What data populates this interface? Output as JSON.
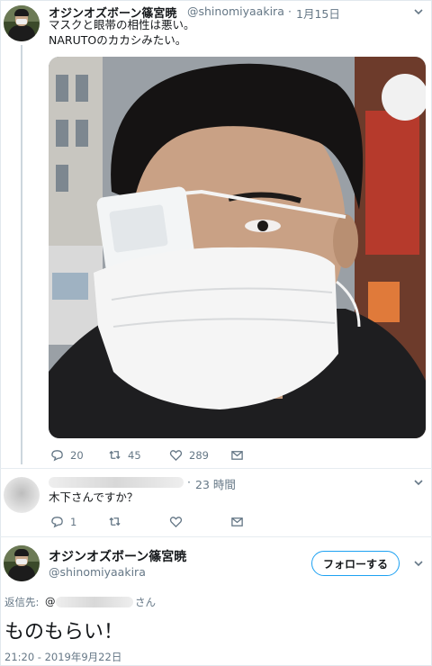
{
  "tweet": {
    "author_name": "オジンオズボーン篠宮暁",
    "author_handle": "@shinomiyaakira",
    "date": "1月15日",
    "separator": "·",
    "text_line1": "マスクと眼帯の相性は悪い。",
    "text_line2": "NARUTOのカカシみたい。",
    "counts": {
      "reply": "20",
      "retweet": "45",
      "like": "289"
    }
  },
  "reply": {
    "time": "23 時間",
    "separator": "·",
    "text": "木下さんですか？",
    "counts": {
      "reply": "1"
    }
  },
  "main": {
    "author_name": "オジンオズボーン篠宮暁",
    "author_handle": "@shinomiyaakira",
    "follow_label": "フォローする",
    "reply_to_label": "返信先:",
    "reply_to_at": "@",
    "reply_to_suffix": "さん",
    "text": "ものもらい！",
    "timestamp": "21:20 - 2019年9月22日"
  },
  "colors": {
    "accent": "#1da1f2",
    "muted": "#657786",
    "text": "#14171a"
  },
  "icons": [
    "reply-icon",
    "retweet-icon",
    "like-icon",
    "message-icon",
    "chevron-down-icon"
  ]
}
